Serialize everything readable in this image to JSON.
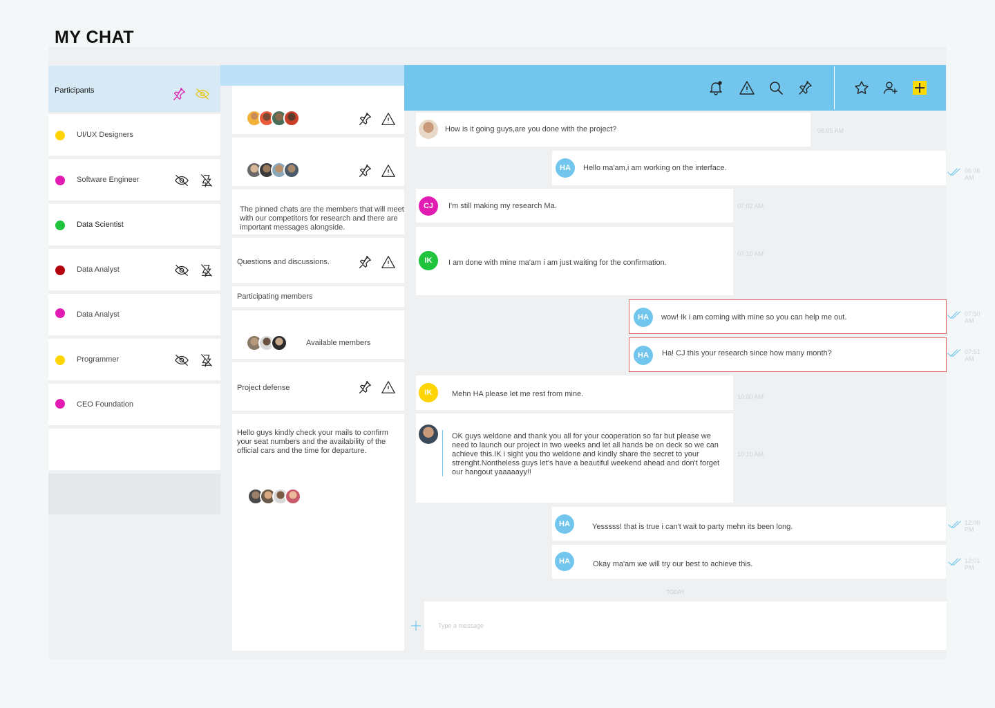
{
  "app": {
    "title": "MY CHAT"
  },
  "participants": {
    "header": "Participants",
    "items": [
      {
        "name": "UI/UX Designers",
        "color": "#ffd400",
        "muted": false
      },
      {
        "name": "Software Engineer",
        "color": "#e21cb2",
        "muted": true
      },
      {
        "name": "Data Scientist",
        "color": "#1fc43c",
        "muted": false
      },
      {
        "name": "Data Analyst",
        "color": "#b3000d",
        "muted": true
      },
      {
        "name": "Data Analyst",
        "color": "#e21cb2",
        "muted": false
      },
      {
        "name": "Programmer",
        "color": "#ffd400",
        "muted": true
      },
      {
        "name": "CEO Foundation",
        "color": "#e21cb2",
        "muted": false
      }
    ]
  },
  "groups": {
    "pinned_note": "The pinned chats are the members that will meet with our competitors for research and there are important messages alongside.",
    "questions": "Questions and discussions.",
    "participating": "Participating members",
    "available": "Available members",
    "defense": "Project defense",
    "notice": "Hello guys kindly check your mails to confirm your seat numbers and the availability of the official cars and the time for departure."
  },
  "chat": {
    "messages": [
      {
        "initials": "",
        "text": "How is it going guys,are you done with the project?",
        "time": "06:05 AM"
      },
      {
        "initials": "HA",
        "text": "Hello ma'am,i am working on the interface.",
        "time": "06:08 AM"
      },
      {
        "initials": "CJ",
        "text": "I'm still making my research Ma.",
        "time": "07:02 AM"
      },
      {
        "initials": "IK",
        "text": "I am done with mine ma'am i am just waiting for the confirmation.",
        "time": "07:10 AM"
      },
      {
        "initials": "HA",
        "text": "wow! Ik  i am coming with mine so you can help me out.",
        "time": "07:50 AM"
      },
      {
        "initials": "HA",
        "text": "Ha! CJ this your research since how many month?",
        "time": "07:51 AM"
      },
      {
        "initials": "IK",
        "text": "Mehn HA please let me rest from mine.",
        "time": "10:00 AM"
      },
      {
        "initials": "",
        "text": "OK guys weldone and thank you all for your cooperation so far but please we need to launch our project in two weeks and let all hands be on deck so we can achieve this.IK i sight you tho weldone and kindly share the secret to your strenght.Nontheless guys let's have a beautiful weekend ahead and don't forget our hangout yaaaaayy!!",
        "time": "10:10 AM"
      },
      {
        "initials": "HA",
        "text": "Yesssss! that is true i can't wait to party mehn its been long.",
        "time": "12:00 PM"
      },
      {
        "initials": "HA",
        "text": "Okay ma'am we will try our best to achieve this.",
        "time": "12:01 PM"
      }
    ],
    "today_label": "TODAY",
    "compose_placeholder": "Type a message"
  },
  "colors": {
    "header_blue": "#72c6ee",
    "light_blue": "#bde1f6",
    "avatar_blue": "#72c6ee",
    "cj_pink": "#e21cb2",
    "ik_green": "#1fc43c",
    "ik_yellow": "#ffd400",
    "highlight_border": "#e06a6a",
    "accent_yellow": "#ffd900"
  },
  "icons": [
    "pin-icon",
    "eye-off-icon",
    "mute-icon",
    "warning-icon",
    "bell-icon",
    "search-icon",
    "star-icon",
    "add-user-icon",
    "plus-icon",
    "double-check-icon"
  ]
}
